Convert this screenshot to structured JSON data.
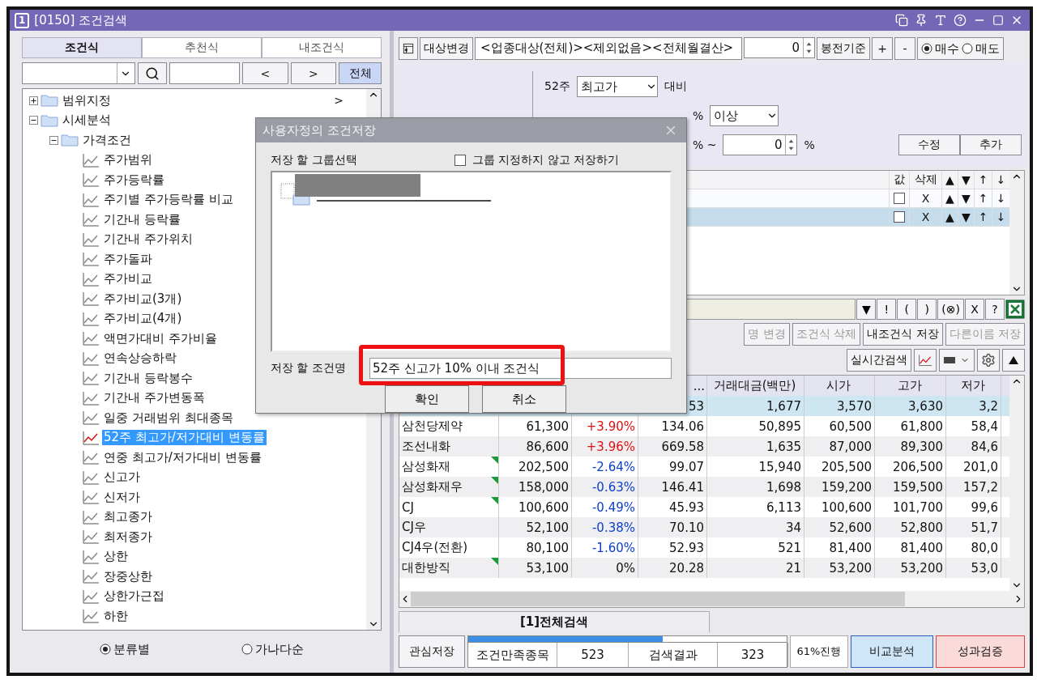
{
  "window": {
    "badge": "1",
    "title": "[0150] 조건검색"
  },
  "left": {
    "tabs": [
      {
        "label": "조건식",
        "selected": true
      },
      {
        "label": "추천식",
        "selected": false
      },
      {
        "label": "내조건식",
        "selected": false
      }
    ],
    "search": {
      "prev": "<",
      "next": ">",
      "all": "전체"
    },
    "tree": [
      {
        "kind": "folder",
        "label": "범위지정",
        "expanded": false,
        "arrow": ">"
      },
      {
        "kind": "folder",
        "label": "시세분석",
        "expanded": true,
        "children": [
          {
            "kind": "folder",
            "label": "가격조건",
            "expanded": true,
            "children": [
              {
                "kind": "leaf",
                "label": "주가범위",
                "selected": false
              },
              {
                "kind": "leaf",
                "label": "주가등락률",
                "selected": false
              },
              {
                "kind": "leaf",
                "label": "주기별 주가등락률 비교",
                "selected": false
              },
              {
                "kind": "leaf",
                "label": "기간내 등락률",
                "selected": false
              },
              {
                "kind": "leaf",
                "label": "기간내 주가위치",
                "selected": false
              },
              {
                "kind": "leaf",
                "label": "주가돌파",
                "selected": false
              },
              {
                "kind": "leaf",
                "label": "주가비교",
                "selected": false
              },
              {
                "kind": "leaf",
                "label": "주가비교(3개)",
                "selected": false
              },
              {
                "kind": "leaf",
                "label": "주가비교(4개)",
                "selected": false
              },
              {
                "kind": "leaf",
                "label": "액면가대비 주가비율",
                "selected": false
              },
              {
                "kind": "leaf",
                "label": "연속상승하락",
                "selected": false
              },
              {
                "kind": "leaf",
                "label": "기간내 등락봉수",
                "selected": false
              },
              {
                "kind": "leaf",
                "label": "기간내 주가변동폭",
                "selected": false
              },
              {
                "kind": "leaf",
                "label": "일중 거래범위 최대종목",
                "selected": false
              },
              {
                "kind": "leaf",
                "label": "52주 최고가/저가대비 변동률",
                "selected": true
              },
              {
                "kind": "leaf",
                "label": "연중 최고가/저가대비 변동률",
                "selected": false
              },
              {
                "kind": "leaf",
                "label": "신고가",
                "selected": false
              },
              {
                "kind": "leaf",
                "label": "신저가",
                "selected": false
              },
              {
                "kind": "leaf",
                "label": "최고종가",
                "selected": false
              },
              {
                "kind": "leaf",
                "label": "최저종가",
                "selected": false
              },
              {
                "kind": "leaf",
                "label": "상한",
                "selected": false
              },
              {
                "kind": "leaf",
                "label": "장중상한",
                "selected": false
              },
              {
                "kind": "leaf",
                "label": "상한가근접",
                "selected": false
              },
              {
                "kind": "leaf",
                "label": "하한",
                "selected": false
              }
            ]
          }
        ]
      }
    ],
    "sort": [
      {
        "label": "분류별",
        "selected": true
      },
      {
        "label": "가나다순",
        "selected": false
      }
    ]
  },
  "toolbar": {
    "target_button": "대상변경",
    "target": "<업종대상(전체)><제외없음><전체월결산>",
    "count": "0",
    "basis": "봉전기준",
    "plus": "+",
    "minus": "-",
    "side": [
      {
        "label": "매수",
        "selected": true
      },
      {
        "label": "매도",
        "selected": false
      }
    ]
  },
  "editor": {
    "period": "52주",
    "price_type": "최고가",
    "compare": "대비",
    "unit": "%",
    "operator": "이상",
    "range_unit": "% ~",
    "range_value": "0",
    "range_end_unit": "%",
    "buttons": [
      "수정",
      "추가"
    ]
  },
  "conditions": {
    "headers": [
      "값",
      "삭제",
      "▲",
      "▼",
      "↑",
      "↓"
    ],
    "rows": [
      {
        "checked": false,
        "delete": "X",
        "up": "▲",
        "down": "▼",
        "top": "↑",
        "bottom": "↓",
        "selected": false
      },
      {
        "checked": false,
        "delete": "X",
        "up": "▲",
        "down": "▼",
        "top": "↑",
        "bottom": "↓",
        "selected": true
      }
    ]
  },
  "formula": {
    "buttons": [
      "▼",
      "!",
      "(",
      ")",
      "(⊗)",
      "X",
      "?"
    ]
  },
  "actions": [
    {
      "label": "명 변경",
      "disabled": true
    },
    {
      "label": "조건식 삭제",
      "disabled": true
    },
    {
      "label": "내조건식 저장",
      "disabled": false
    },
    {
      "label": "다른이름 저장",
      "disabled": true
    }
  ],
  "realtime": "실시간검색",
  "table": {
    "columns": [
      "...",
      "거래대금(백만)",
      "시가",
      "고가",
      "저가"
    ],
    "rows": [
      {
        "ratio": "53",
        "values": [
          "1,677",
          "3,570",
          "3,630",
          "3,2"
        ],
        "selected": true,
        "flag": false
      },
      {
        "name": "삼천당제약",
        "price": "61,300",
        "change": "+3.90%",
        "color": "#e01010",
        "ratio": "134.06",
        "values": [
          "50,895",
          "60,500",
          "61,800",
          "58,4"
        ],
        "selected": false,
        "flag": false
      },
      {
        "name": "조선내화",
        "price": "86,600",
        "change": "+3.96%",
        "color": "#e01010",
        "ratio": "669.58",
        "values": [
          "1,635",
          "87,000",
          "89,300",
          "84,6"
        ],
        "selected": false,
        "flag": false
      },
      {
        "name": "삼성화재",
        "price": "202,500",
        "change": "-2.64%",
        "color": "#0b3fc8",
        "ratio": "99.07",
        "values": [
          "15,940",
          "205,500",
          "206,500",
          "201,0"
        ],
        "selected": false,
        "flag": true
      },
      {
        "name": "삼성화재우",
        "price": "158,000",
        "change": "-0.63%",
        "color": "#0b3fc8",
        "ratio": "146.41",
        "values": [
          "1,698",
          "159,200",
          "159,500",
          "157,2"
        ],
        "selected": false,
        "flag": true
      },
      {
        "name": "CJ",
        "price": "100,600",
        "change": "-0.49%",
        "color": "#0b3fc8",
        "ratio": "45.93",
        "values": [
          "6,113",
          "100,600",
          "101,700",
          "99,6"
        ],
        "selected": false,
        "flag": true
      },
      {
        "name": "CJ우",
        "price": "52,100",
        "change": "-0.38%",
        "color": "#0b3fc8",
        "ratio": "70.10",
        "values": [
          "34",
          "52,600",
          "52,800",
          "51,7"
        ],
        "selected": false,
        "flag": false
      },
      {
        "name": "CJ4우(전환)",
        "price": "80,100",
        "change": "-1.60%",
        "color": "#0b3fc8",
        "ratio": "52.93",
        "values": [
          "521",
          "81,400",
          "81,400",
          "80,0"
        ],
        "selected": false,
        "flag": false
      },
      {
        "name": "대한방직",
        "price": "53,100",
        "change": "0%",
        "color": "#111111",
        "ratio": "20.28",
        "values": [
          "21",
          "53,200",
          "53,200",
          "53,0"
        ],
        "selected": false,
        "flag": true
      }
    ]
  },
  "result_tabs": [
    {
      "label": "[1]전체검색",
      "selected": true
    }
  ],
  "footer": {
    "save": "관심저장",
    "level": 0.61,
    "cells": [
      "조건만족종목",
      "523",
      "검색결과",
      "323"
    ],
    "progress": "61%진행",
    "compare": "비교분석",
    "verify": "성과검증"
  },
  "dialog": {
    "title": "사용자정의 조건저장",
    "group_label": "저장 할 그룹선택",
    "no_group": {
      "label": "그룹 지정하지 않고 저장하기",
      "checked": false
    },
    "name_label": "저장 할 조건명",
    "name_value": "52주 신고가 10% 이내 조건식",
    "highlighted": true,
    "buttons": [
      "확인",
      "취소"
    ]
  }
}
